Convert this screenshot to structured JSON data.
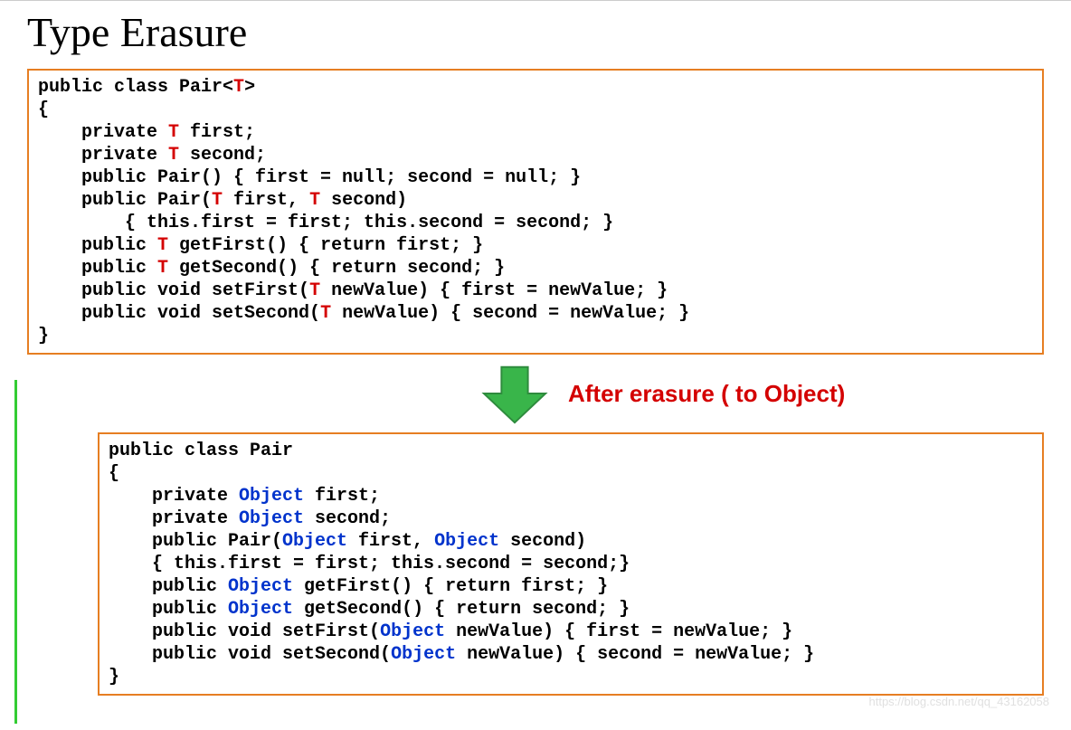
{
  "title": "Type Erasure",
  "arrow_label": "After erasure ( to Object)",
  "watermark": "https://blog.csdn.net/qq_43162058",
  "generic_type": "T",
  "erased_type": "Object",
  "code1": {
    "l1a": "public class Pair<",
    "l1b": ">",
    "l2": "{",
    "l3a": "    private ",
    "l3b": " first;",
    "l4a": "    private ",
    "l4b": " second;",
    "l5": "    public Pair() { first = null; second = null; }",
    "l6a": "    public Pair(",
    "l6b": " first, ",
    "l6c": " second)",
    "l7": "        { this.first = first; this.second = second; }",
    "l8a": "    public ",
    "l8b": " getFirst() { return first; }",
    "l9a": "    public ",
    "l9b": " getSecond() { return second; }",
    "l10a": "    public void setFirst(",
    "l10b": " newValue) { first = newValue; }",
    "l11a": "    public void setSecond(",
    "l11b": " newValue) { second = newValue; }",
    "l12": "}"
  },
  "code2": {
    "l1": "public class Pair",
    "l2": "{",
    "l3a": "    private ",
    "l3b": " first;",
    "l4a": "    private ",
    "l4b": " second;",
    "l5a": "    public Pair(",
    "l5b": " first, ",
    "l5c": " second)",
    "l6": "    { this.first = first; this.second = second;}",
    "l7a": "    public ",
    "l7b": " getFirst() { return first; }",
    "l8a": "    public ",
    "l8b": " getSecond() { return second; }",
    "l9a": "    public void setFirst(",
    "l9b": " newValue) { first = newValue; }",
    "l10a": "    public void setSecond(",
    "l10b": " newValue) { second = newValue; }",
    "l11": "}"
  }
}
